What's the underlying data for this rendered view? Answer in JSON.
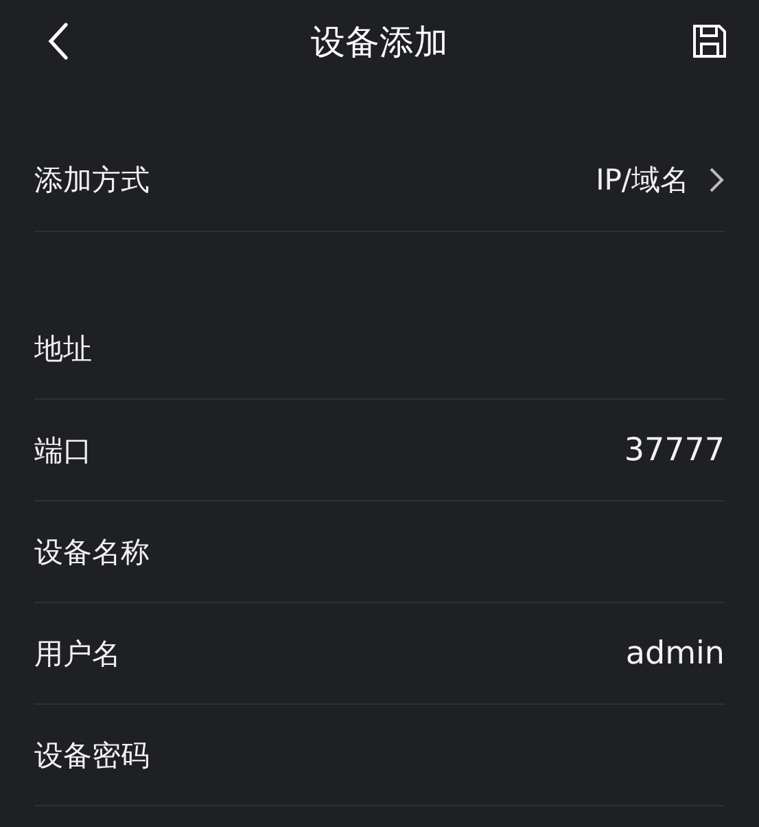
{
  "header": {
    "title": "设备添加"
  },
  "sections": [
    {
      "rows": [
        {
          "kind": "link",
          "label": "添加方式",
          "value": "IP/域名"
        }
      ]
    },
    {
      "rows": [
        {
          "kind": "field",
          "label": "地址"
        },
        {
          "kind": "field",
          "label": "端口",
          "value": "37777"
        },
        {
          "kind": "field",
          "label": "设备名称"
        },
        {
          "kind": "field",
          "label": "用户名",
          "value": "admin"
        },
        {
          "kind": "field",
          "label": "设备密码"
        }
      ]
    }
  ]
}
